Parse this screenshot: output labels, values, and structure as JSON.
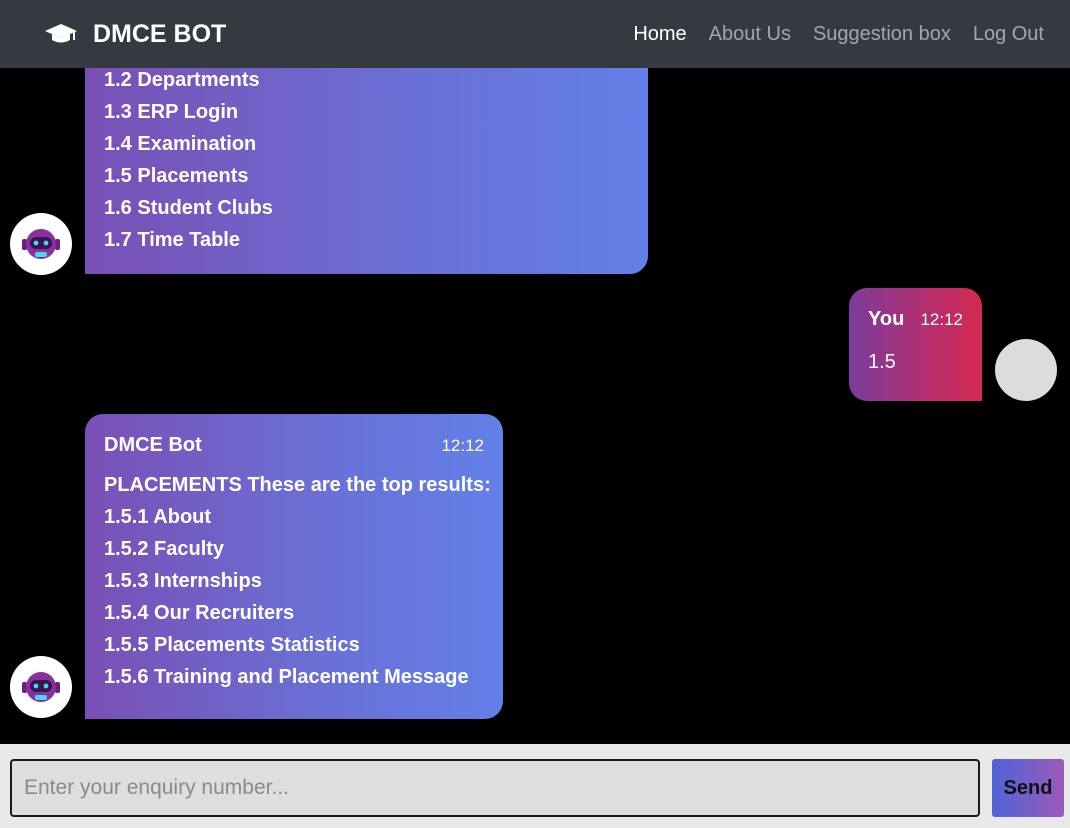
{
  "navbar": {
    "brand": "DMCE BOT",
    "brand_icon": "graduation-cap-icon",
    "links": [
      {
        "label": "Home",
        "active": true
      },
      {
        "label": "About Us",
        "active": false
      },
      {
        "label": "Suggestion box",
        "active": false
      },
      {
        "label": "Log Out",
        "active": false
      }
    ]
  },
  "chat": {
    "messages": [
      {
        "sender": "bot",
        "lines": [
          "1.2 Departments",
          "1.3 ERP Login",
          "1.4 Examination",
          "1.5 Placements",
          "1.6 Student Clubs",
          "1.7 Time Table"
        ]
      },
      {
        "sender": "user",
        "name": "You",
        "time": "12:12",
        "text": "1.5"
      },
      {
        "sender": "bot",
        "name": "DMCE Bot",
        "time": "12:12",
        "lines": [
          "PLACEMENTS These are the top results:",
          "1.5.1 About",
          "1.5.2 Faculty",
          "1.5.3 Internships",
          "1.5.4 Our Recruiters",
          "1.5.5 Placements Statistics",
          "1.5.6 Training and Placement Message"
        ]
      }
    ]
  },
  "composer": {
    "placeholder": "Enter your enquiry number...",
    "value": "",
    "send_label": "Send"
  },
  "colors": {
    "navbar": "#343a40",
    "bot_bubble_start": "#7a4fb5",
    "bot_bubble_end": "#6280e8",
    "user_bubble_start": "#7a3c9c",
    "user_bubble_end": "#d42a4f"
  }
}
